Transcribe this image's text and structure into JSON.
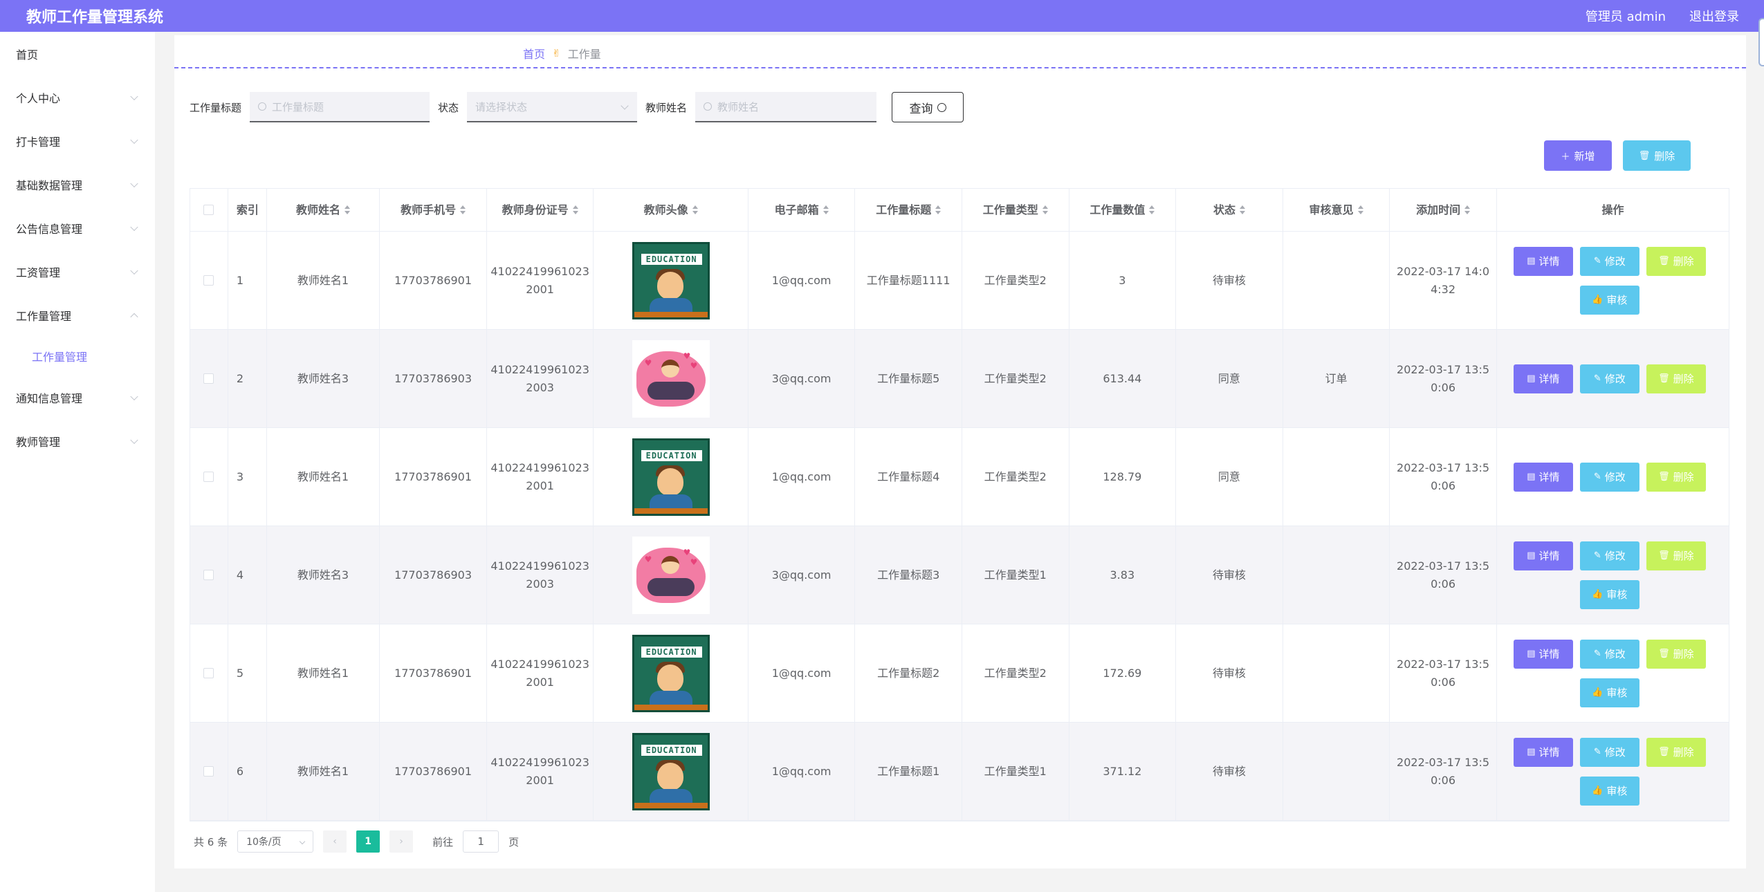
{
  "header": {
    "title": "教师工作量管理系统",
    "user": "管理员 admin",
    "logout": "退出登录"
  },
  "sidebar": {
    "items": [
      {
        "label": "首页"
      },
      {
        "label": "个人中心"
      },
      {
        "label": "打卡管理"
      },
      {
        "label": "基础数据管理"
      },
      {
        "label": "公告信息管理"
      },
      {
        "label": "工资管理"
      },
      {
        "label": "工作量管理"
      },
      {
        "label": "通知信息管理"
      },
      {
        "label": "教师管理"
      }
    ],
    "sub": "工作量管理"
  },
  "breadcrumb": {
    "home": "首页",
    "current": "工作量"
  },
  "filters": {
    "title_label": "工作量标题",
    "title_placeholder": "工作量标题",
    "status_label": "状态",
    "status_placeholder": "请选择状态",
    "teacher_label": "教师姓名",
    "teacher_placeholder": "教师姓名",
    "query": "查询"
  },
  "actions": {
    "add": "新增",
    "delete": "删除"
  },
  "table": {
    "headers": [
      "索引",
      "教师姓名",
      "教师手机号",
      "教师身份证号",
      "教师头像",
      "电子邮箱",
      "工作量标题",
      "工作量类型",
      "工作量数值",
      "状态",
      "审核意见",
      "添加时间",
      "操作"
    ],
    "ops": {
      "detail": "详情",
      "edit": "修改",
      "remove": "删除",
      "audit": "审核"
    },
    "rows": [
      {
        "index": "1",
        "name": "教师姓名1",
        "phone": "17703786901",
        "id_line1": "41022419961023",
        "id_line2": "2001",
        "avatar": "education",
        "email": "1@qq.com",
        "title": "工作量标题1111",
        "type": "工作量类型2",
        "value": "3",
        "status": "待审核",
        "opinion": "",
        "time_line1": "2022-03-17 14:0",
        "time_line2": "4:32"
      },
      {
        "index": "2",
        "name": "教师姓名3",
        "phone": "17703786903",
        "id_line1": "41022419961023",
        "id_line2": "2003",
        "avatar": "love",
        "email": "3@qq.com",
        "title": "工作量标题5",
        "type": "工作量类型2",
        "value": "613.44",
        "status": "同意",
        "opinion": "订单",
        "time_line1": "2022-03-17 13:5",
        "time_line2": "0:06"
      },
      {
        "index": "3",
        "name": "教师姓名1",
        "phone": "17703786901",
        "id_line1": "41022419961023",
        "id_line2": "2001",
        "avatar": "education",
        "email": "1@qq.com",
        "title": "工作量标题4",
        "type": "工作量类型2",
        "value": "128.79",
        "status": "同意",
        "opinion": "",
        "time_line1": "2022-03-17 13:5",
        "time_line2": "0:06"
      },
      {
        "index": "4",
        "name": "教师姓名3",
        "phone": "17703786903",
        "id_line1": "41022419961023",
        "id_line2": "2003",
        "avatar": "love",
        "email": "3@qq.com",
        "title": "工作量标题3",
        "type": "工作量类型1",
        "value": "3.83",
        "status": "待审核",
        "opinion": "",
        "time_line1": "2022-03-17 13:5",
        "time_line2": "0:06"
      },
      {
        "index": "5",
        "name": "教师姓名1",
        "phone": "17703786901",
        "id_line1": "41022419961023",
        "id_line2": "2001",
        "avatar": "education",
        "email": "1@qq.com",
        "title": "工作量标题2",
        "type": "工作量类型2",
        "value": "172.69",
        "status": "待审核",
        "opinion": "",
        "time_line1": "2022-03-17 13:5",
        "time_line2": "0:06"
      },
      {
        "index": "6",
        "name": "教师姓名1",
        "phone": "17703786901",
        "id_line1": "41022419961023",
        "id_line2": "2001",
        "avatar": "education",
        "email": "1@qq.com",
        "title": "工作量标题1",
        "type": "工作量类型1",
        "value": "371.12",
        "status": "待审核",
        "opinion": "",
        "time_line1": "2022-03-17 13:5",
        "time_line2": "0:06"
      }
    ]
  },
  "avatar_text": "EDUCATION",
  "pagination": {
    "total": "共 6 条",
    "page_size": "10条/页",
    "current_page": "1",
    "goto_label": "前往",
    "goto_value": "1",
    "page_suffix": "页"
  }
}
